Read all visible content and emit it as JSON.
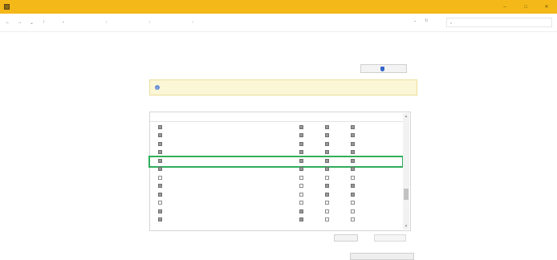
{
  "window": {
    "title": "",
    "controls": [
      "–",
      "□",
      "✕"
    ]
  },
  "address_bar": {
    "breadcrumbs": [
      "",
      "",
      "",
      ""
    ],
    "search_placeholder": ""
  },
  "main": {
    "heading": "",
    "subheading": "",
    "risk_link": "",
    "change_settings_label": "",
    "notice_text": "",
    "list_title": "",
    "columns": [
      "",
      "",
      "",
      "",
      ""
    ],
    "rows": [
      {
        "name": "",
        "enabled": true,
        "domain": true,
        "private": true,
        "public": true,
        "group_policy": ""
      },
      {
        "name": "",
        "enabled": true,
        "domain": true,
        "private": true,
        "public": true,
        "group_policy": ""
      },
      {
        "name": "",
        "enabled": true,
        "domain": true,
        "private": true,
        "public": true,
        "group_policy": ""
      },
      {
        "name": "",
        "enabled": true,
        "domain": true,
        "private": true,
        "public": true,
        "group_policy": ""
      },
      {
        "name": "",
        "enabled": true,
        "domain": true,
        "private": true,
        "public": true,
        "group_policy": ""
      },
      {
        "name": "",
        "enabled": true,
        "domain": true,
        "private": true,
        "public": true,
        "group_policy": ""
      },
      {
        "name": "",
        "enabled": false,
        "domain": false,
        "private": false,
        "public": false,
        "group_policy": ""
      },
      {
        "name": "",
        "enabled": true,
        "domain": false,
        "private": true,
        "public": true,
        "group_policy": ""
      },
      {
        "name": "",
        "enabled": true,
        "domain": false,
        "private": true,
        "public": true,
        "group_policy": ""
      },
      {
        "name": "",
        "enabled": false,
        "domain": false,
        "private": false,
        "public": false,
        "group_policy": ""
      },
      {
        "name": "",
        "enabled": true,
        "domain": true,
        "private": false,
        "public": false,
        "group_policy": ""
      },
      {
        "name": "",
        "enabled": true,
        "domain": true,
        "private": false,
        "public": false,
        "group_policy": ""
      }
    ],
    "selected_row_index": 4,
    "details_label": "",
    "remove_label": "",
    "allow_another_label": ""
  }
}
